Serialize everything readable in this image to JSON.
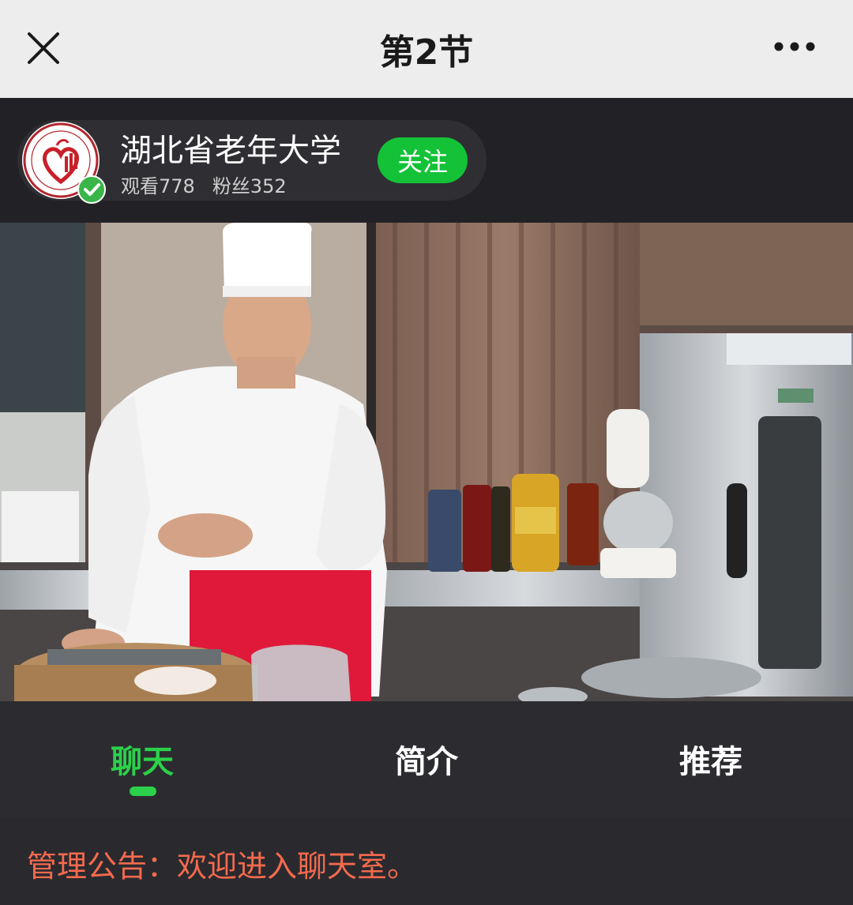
{
  "topbar": {
    "title": "第2节"
  },
  "channel": {
    "name": "湖北省老年大学",
    "views_label": "观看778",
    "fans_label": "粉丝352",
    "follow_label": "关注"
  },
  "tabs": [
    {
      "label": "聊天",
      "active": true
    },
    {
      "label": "简介",
      "active": false
    },
    {
      "label": "推荐",
      "active": false
    }
  ],
  "chat": {
    "notice": "管理公告：欢迎进入聊天室。"
  },
  "colors": {
    "accent_green": "#2bd14a",
    "follow_green": "#14c238",
    "notice_orange": "#f46a4e"
  }
}
